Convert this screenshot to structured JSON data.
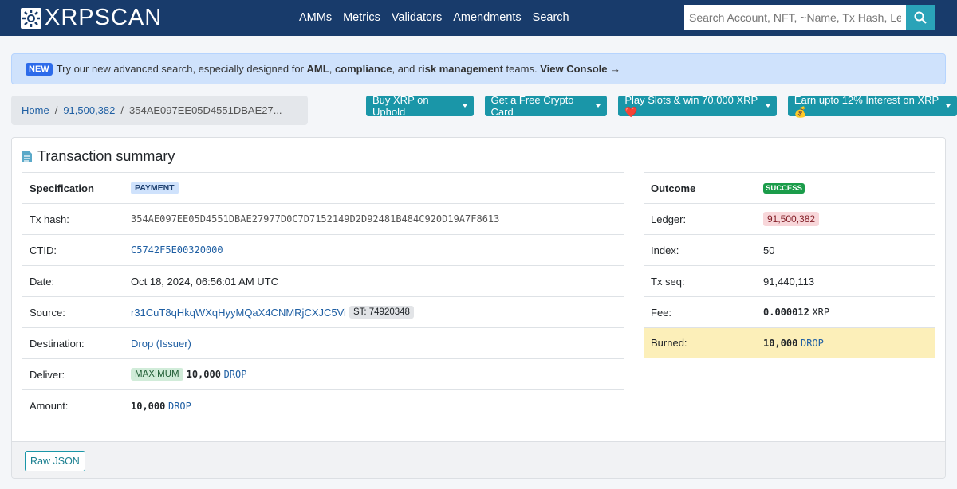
{
  "nav": {
    "brand": "XRPSCAN",
    "items": [
      "AMMs",
      "Metrics",
      "Validators",
      "Amendments",
      "Search"
    ],
    "search_placeholder": "Search Account, NFT, ~Name, Tx Hash, Ledger"
  },
  "alert": {
    "badge": "NEW",
    "t1": "Try our new advanced search, especially designed for ",
    "b1": "AML",
    ",": ", ",
    "b2": "compliance",
    "t2": ", and ",
    "b3": "risk management",
    "t3": " teams. ",
    "cta": "View Console →"
  },
  "breadcrumb": {
    "home": "Home",
    "ledger": "91,500,382",
    "tx": "354AE097EE05D4551DBAE27..."
  },
  "promos": [
    "Buy XRP on Uphold",
    "Get a Free Crypto Card",
    "Play Slots & win 70,000 XRP❤️",
    "Earn upto 12% Interest on XRP💰"
  ],
  "card": {
    "title": "Transaction summary",
    "raw_json": "Raw JSON"
  },
  "left": {
    "spec_label": "Specification",
    "spec_value": "PAYMENT",
    "hash_label": "Tx hash:",
    "hash": "354AE097EE05D4551DBAE27977D0C7D7152149D2D92481B484C920D19A7F8613",
    "ctid_label": "CTID:",
    "ctid": "C5742F5E00320000",
    "date_label": "Date:",
    "date": "Oct 18, 2024, 06:56:01 AM UTC",
    "source_label": "Source:",
    "source": "r31CuT8qHkqWXqHyyMQaX4CNMRjCXJC5Vi",
    "source_tag": "ST: 74920348",
    "dest_label": "Destination:",
    "dest": "Drop (Issuer)",
    "deliver_label": "Deliver:",
    "deliver_tag": "MAXIMUM",
    "deliver_amount": "10,000",
    "deliver_currency": "DROP",
    "amount_label": "Amount:",
    "amount": "10,000",
    "amount_currency": "DROP"
  },
  "right": {
    "outcome_label": "Outcome",
    "outcome": "SUCCESS",
    "ledger_label": "Ledger:",
    "ledger": "91,500,382",
    "index_label": "Index:",
    "index": "50",
    "seq_label": "Tx seq:",
    "seq": "91,440,113",
    "fee_label": "Fee:",
    "fee": "0.000012",
    "fee_currency": "XRP",
    "burned_label": "Burned:",
    "burned": "10,000",
    "burned_currency": "DROP"
  }
}
